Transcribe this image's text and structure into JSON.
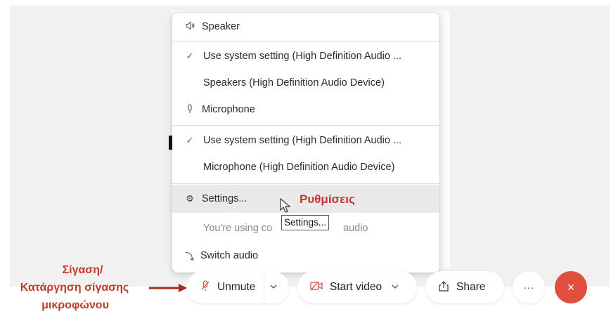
{
  "menu": {
    "speaker_header": "Speaker",
    "speaker_system": "Use system setting (High Definition Audio ...",
    "speaker_device": "Speakers (High Definition Audio Device)",
    "microphone_header": "Microphone",
    "mic_system": "Use system setting (High Definition Audio ...",
    "mic_device": "Microphone (High Definition Audio Device)",
    "settings": "Settings...",
    "using_prefix": "You're using co",
    "using_suffix": "audio",
    "switch_audio": "Switch audio"
  },
  "tooltip": {
    "text": "Settings..."
  },
  "annotations": {
    "settings_greek": "Ρυθμίσεις",
    "mute_line1": "Σίγαση/",
    "mute_line2": "Κατάργηση σίγασης",
    "mute_line3": "μικροφώνου"
  },
  "toolbar": {
    "unmute": "Unmute",
    "start_video": "Start video",
    "share": "Share",
    "more": "···",
    "leave": "×"
  },
  "icons": {
    "speaker": "speaker-icon",
    "check": "checkmark-icon",
    "microphone": "microphone-icon",
    "gear": "gear-icon",
    "switch": "switch-audio-icon",
    "mic_muted": "microphone-muted-icon",
    "video_off": "video-off-icon",
    "share": "share-icon",
    "more": "more-icon",
    "leave": "close-icon"
  },
  "colors": {
    "accent_red": "#d9473a",
    "annotation_red": "#c0392b",
    "check_blue": "#2f6fd6",
    "leave_red": "#e04f3e"
  }
}
